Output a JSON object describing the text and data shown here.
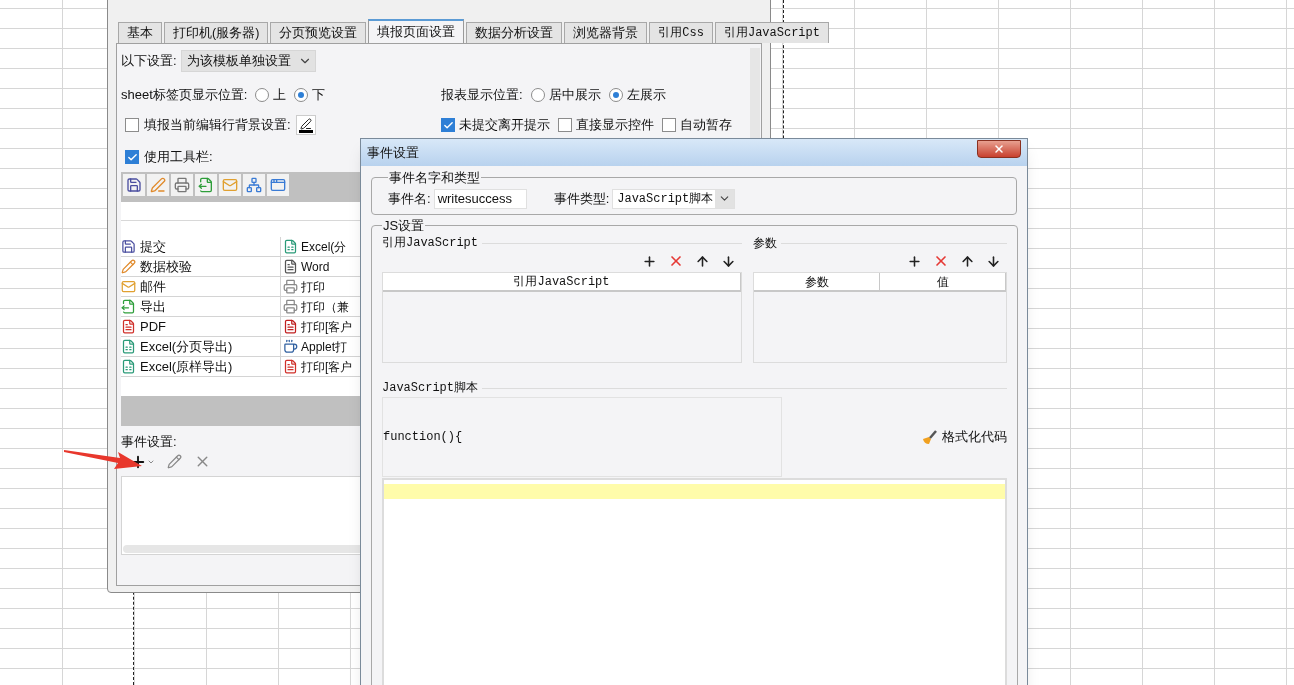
{
  "template_dialog": {
    "tabs": [
      {
        "label": "基本",
        "selected": false
      },
      {
        "label": "打印机(服务器)",
        "selected": false
      },
      {
        "label": "分页预览设置",
        "selected": false
      },
      {
        "label": "填报页面设置",
        "selected": true
      },
      {
        "label": "数据分析设置",
        "selected": false
      },
      {
        "label": "浏览器背景",
        "selected": false
      },
      {
        "label": "引用Css",
        "selected": false
      },
      {
        "label": "引用JavaScript",
        "selected": false
      }
    ],
    "scope": {
      "label": "以下设置:",
      "value": "为该模板单独设置"
    },
    "sheet_position": {
      "label": "sheet标签页显示位置:",
      "options": [
        {
          "label": "上",
          "selected": false
        },
        {
          "label": "下",
          "selected": true
        }
      ]
    },
    "report_position": {
      "label": "报表显示位置:",
      "options": [
        {
          "label": "居中展示",
          "selected": false
        },
        {
          "label": "左展示",
          "selected": true
        }
      ]
    },
    "row_background": {
      "label": "填报当前编辑行背景设置:",
      "checked": false
    },
    "options": [
      {
        "label": "未提交离开提示",
        "checked": true
      },
      {
        "label": "直接显示控件",
        "checked": false
      },
      {
        "label": "自动暂存",
        "checked": false
      }
    ],
    "use_toolbar": {
      "label": "使用工具栏:",
      "checked": true
    },
    "button_rows": [
      {
        "left": "提交",
        "right": "Excel(分"
      },
      {
        "left": "数据校验",
        "right": "Word"
      },
      {
        "left": "邮件",
        "right": "打印"
      },
      {
        "left": "导出",
        "right": "打印（兼"
      },
      {
        "left": "PDF",
        "right": "打印[客户"
      },
      {
        "left": "Excel(分页导出)",
        "right": "Applet打"
      },
      {
        "left": "Excel(原样导出)",
        "right": "打印[客户"
      }
    ],
    "events_label": "事件设置:"
  },
  "event_dialog": {
    "title": "事件设置",
    "name_group": {
      "legend": "事件名字和类型",
      "name_label": "事件名:",
      "name_value": "writesuccess",
      "type_label": "事件类型:",
      "type_value": "JavaScript脚本"
    },
    "js_group": {
      "legend": "JS设置",
      "references": {
        "title": "引用JavaScript",
        "columns": [
          "引用JavaScript"
        ]
      },
      "parameters": {
        "title": "参数",
        "columns": [
          "参数",
          "值"
        ]
      },
      "script": {
        "title": "JavaScript脚本",
        "header": "function(){",
        "format_button": "格式化代码"
      }
    }
  }
}
